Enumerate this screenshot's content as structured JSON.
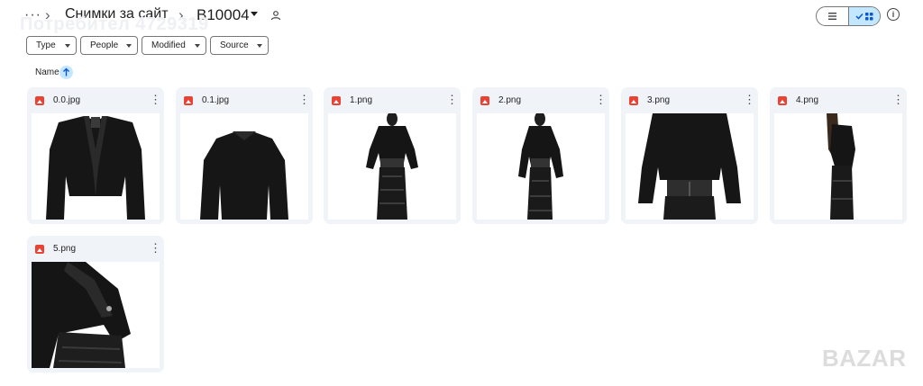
{
  "header": {
    "more_label": "···",
    "breadcrumb": [
      "Снимки за сайт",
      "B10004"
    ],
    "watermark": "Потребител 4729319"
  },
  "filters": [
    {
      "label": "Type"
    },
    {
      "label": "People"
    },
    {
      "label": "Modified"
    },
    {
      "label": "Source"
    }
  ],
  "sort": {
    "label": "Name"
  },
  "files": [
    {
      "name": "0.0.jpg"
    },
    {
      "name": "0.1.jpg"
    },
    {
      "name": "1.png"
    },
    {
      "name": "2.png"
    },
    {
      "name": "3.png"
    },
    {
      "name": "4.png"
    },
    {
      "name": "5.png"
    }
  ],
  "colors": {
    "accent": "#c2e7ff",
    "card_bg": "#f0f4f9",
    "image_icon": "#ea4335"
  },
  "bottom_watermark": "BAZAR"
}
